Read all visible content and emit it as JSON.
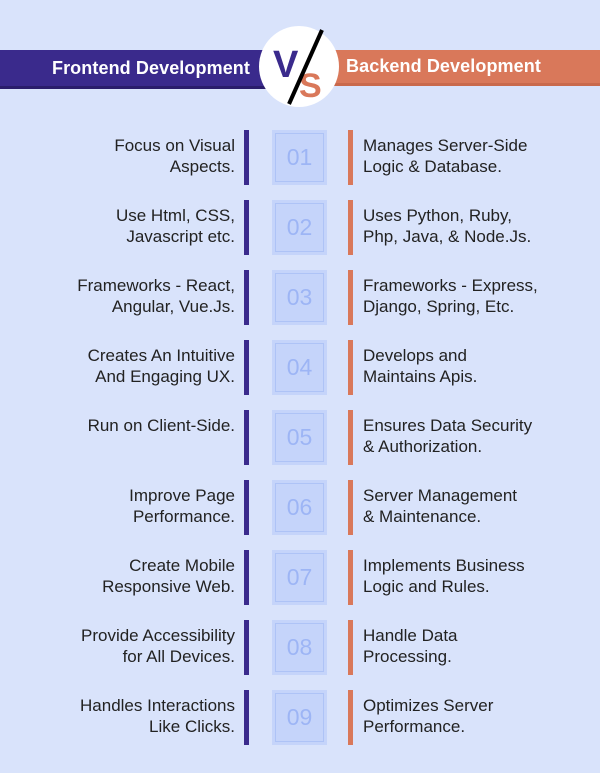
{
  "header": {
    "left_title": "Frontend Development",
    "right_title": "Backend Development",
    "vs_left_letter": "V",
    "vs_right_letter": "S",
    "colors": {
      "frontend": "#3a2a8c",
      "backend": "#d9785a",
      "background": "#d9e3fb"
    }
  },
  "rows": [
    {
      "number": "01",
      "frontend": [
        "Focus on Visual",
        "Aspects."
      ],
      "backend": [
        "Manages Server-Side",
        "Logic & Database."
      ]
    },
    {
      "number": "02",
      "frontend": [
        "Use Html, CSS,",
        "Javascript etc."
      ],
      "backend": [
        "Uses Python, Ruby,",
        "Php, Java, & Node.Js."
      ]
    },
    {
      "number": "03",
      "frontend": [
        "Frameworks - React,",
        "Angular, Vue.Js."
      ],
      "backend": [
        "Frameworks - Express,",
        "Django, Spring, Etc."
      ]
    },
    {
      "number": "04",
      "frontend": [
        "Creates An Intuitive",
        "And Engaging UX."
      ],
      "backend": [
        "Develops and",
        "Maintains Apis."
      ]
    },
    {
      "number": "05",
      "frontend": [
        "Run on Client-Side.",
        ""
      ],
      "backend": [
        "Ensures Data Security",
        "& Authorization."
      ]
    },
    {
      "number": "06",
      "frontend": [
        "Improve Page",
        "Performance."
      ],
      "backend": [
        "Server Management",
        "& Maintenance."
      ]
    },
    {
      "number": "07",
      "frontend": [
        "Create Mobile",
        "Responsive Web."
      ],
      "backend": [
        "Implements Business",
        "Logic and Rules."
      ]
    },
    {
      "number": "08",
      "frontend": [
        "Provide Accessibility",
        "for All Devices."
      ],
      "backend": [
        "Handle Data",
        "Processing."
      ]
    },
    {
      "number": "09",
      "frontend": [
        "Handles Interactions",
        "Like Clicks."
      ],
      "backend": [
        "Optimizes Server",
        "Performance."
      ]
    }
  ]
}
